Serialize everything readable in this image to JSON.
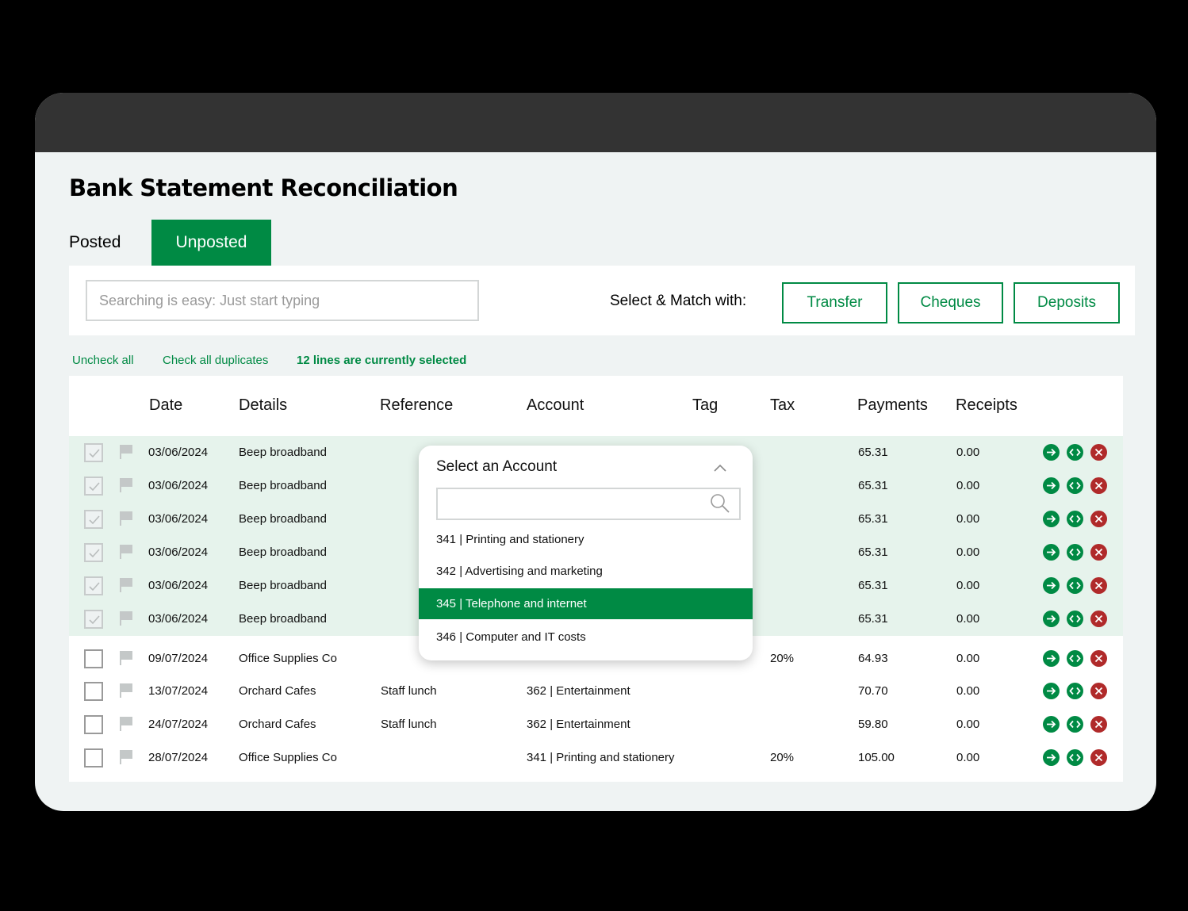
{
  "page": {
    "title": "Bank Statement Reconciliation",
    "tabs": {
      "posted": "Posted",
      "unposted": "Unposted"
    }
  },
  "toolbar": {
    "search_placeholder": "Searching is easy: Just start typing",
    "match_label": "Select & Match with:",
    "buttons": {
      "transfer": "Transfer",
      "cheques": "Cheques",
      "deposits": "Deposits"
    }
  },
  "selection": {
    "uncheck_all": "Uncheck all",
    "check_duplicates": "Check all duplicates",
    "status": "12 lines are currently selected"
  },
  "table": {
    "headers": {
      "date": "Date",
      "details": "Details",
      "reference": "Reference",
      "account": "Account",
      "tag": "Tag",
      "tax": "Tax",
      "payments": "Payments",
      "receipts": "Receipts"
    },
    "rows": [
      {
        "checked": true,
        "date": "03/06/2024",
        "details": "Beep broadband",
        "reference": "",
        "account": "",
        "tag": "",
        "tax": "",
        "payments": "65.31",
        "receipts": "0.00"
      },
      {
        "checked": true,
        "date": "03/06/2024",
        "details": "Beep broadband",
        "reference": "",
        "account": "",
        "tag": "",
        "tax": "",
        "payments": "65.31",
        "receipts": "0.00"
      },
      {
        "checked": true,
        "date": "03/06/2024",
        "details": "Beep broadband",
        "reference": "",
        "account": "",
        "tag": "",
        "tax": "",
        "payments": "65.31",
        "receipts": "0.00"
      },
      {
        "checked": true,
        "date": "03/06/2024",
        "details": "Beep broadband",
        "reference": "",
        "account": "",
        "tag": "",
        "tax": "",
        "payments": "65.31",
        "receipts": "0.00"
      },
      {
        "checked": true,
        "date": "03/06/2024",
        "details": "Beep broadband",
        "reference": "",
        "account": "",
        "tag": "",
        "tax": "",
        "payments": "65.31",
        "receipts": "0.00"
      },
      {
        "checked": true,
        "date": "03/06/2024",
        "details": "Beep broadband",
        "reference": "",
        "account": "",
        "tag": "",
        "tax": "",
        "payments": "65.31",
        "receipts": "0.00"
      },
      {
        "checked": false,
        "date": "09/07/2024",
        "details": "Office Supplies Co",
        "reference": "",
        "account": "",
        "tag": "",
        "tax": "20%",
        "payments": "64.93",
        "receipts": "0.00"
      },
      {
        "checked": false,
        "date": "13/07/2024",
        "details": "Orchard Cafes",
        "reference": "Staff lunch",
        "account": "362 | Entertainment",
        "tag": "",
        "tax": "",
        "payments": "70.70",
        "receipts": "0.00"
      },
      {
        "checked": false,
        "date": "24/07/2024",
        "details": "Orchard Cafes",
        "reference": "Staff lunch",
        "account": "362 | Entertainment",
        "tag": "",
        "tax": "",
        "payments": "59.80",
        "receipts": "0.00"
      },
      {
        "checked": false,
        "date": "28/07/2024",
        "details": "Office Supplies Co",
        "reference": "",
        "account": "341 | Printing and stationery",
        "tag": "",
        "tax": "20%",
        "payments": "105.00",
        "receipts": "0.00"
      }
    ]
  },
  "account_dropdown": {
    "title": "Select an Account",
    "search_value": "",
    "options": [
      {
        "label": "341 | Printing and stationery",
        "active": false
      },
      {
        "label": "342 | Advertising and marketing",
        "active": false
      },
      {
        "label": "345 | Telephone and internet",
        "active": true
      },
      {
        "label": "346 | Computer and IT costs",
        "active": false
      }
    ]
  },
  "icons": {
    "checkbox": "checkmark-icon",
    "flag": "flag-icon",
    "actions": [
      "arrow-right-icon",
      "match-arrows-icon",
      "close-icon"
    ],
    "dropdown": [
      "chevron-up-icon",
      "search-icon"
    ]
  },
  "colors": {
    "accent": "#008a44",
    "selected_row": "#e6f3ec",
    "delete": "#b02a2a",
    "titlebar": "#333333",
    "window_bg": "#eff3f3"
  }
}
